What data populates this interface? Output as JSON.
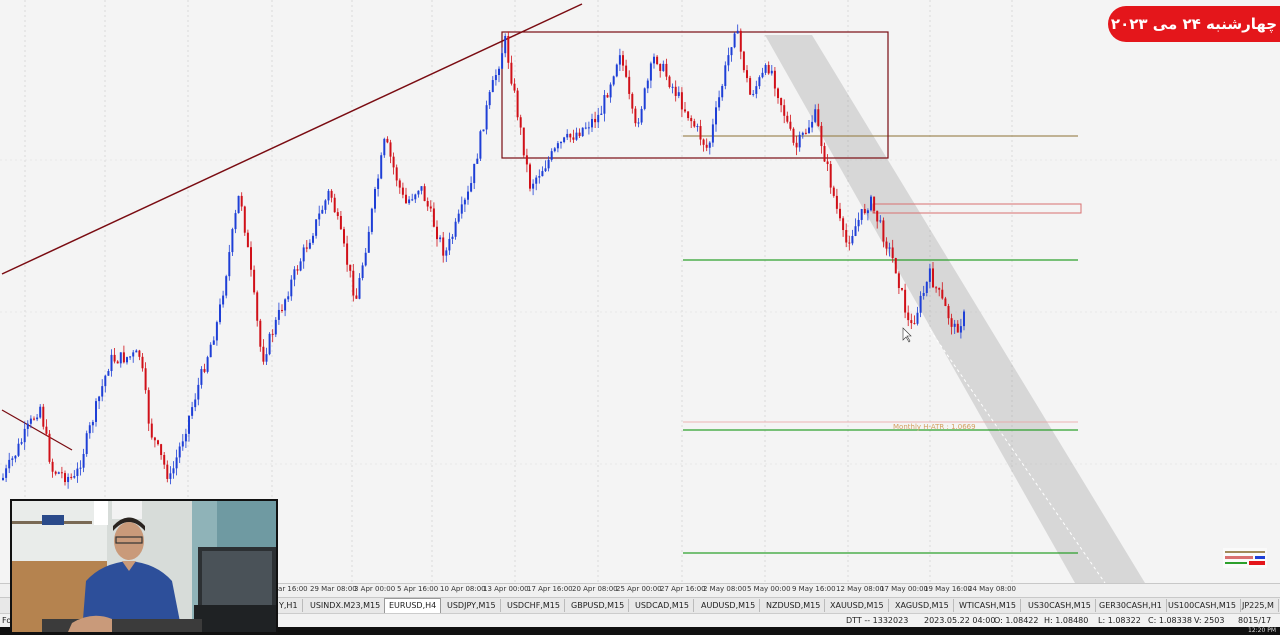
{
  "date_badge": "چهارشنبه ۲۴ می ۲۰۲۳",
  "chart": {
    "symbol_tab": "EURUSD,H4",
    "annotation": "Monthly H-ATR : 1.0669",
    "time_labels": [
      "Mar 16:00",
      "29 Mar 08:00",
      "3 Apr 00:00",
      "5 Apr 16:00",
      "10 Apr 08:00",
      "13 Apr 00:00",
      "17 Apr 16:00",
      "20 Apr 08:00",
      "25 Apr 00:00",
      "27 Apr 16:00",
      "2 May 08:00",
      "5 May 00:00",
      "9 May 16:00",
      "12 May 08:00",
      "17 May 00:00",
      "19 May 16:00",
      "24 May 08:00"
    ],
    "colors": {
      "bull": "#1e3fd6",
      "bear": "#d01018",
      "trendline": "#7a0c12",
      "box": "#7a0c12",
      "green_level": "#2ca02c",
      "olive_level": "#a08a5a",
      "channel": "#9a9a9a"
    }
  },
  "tabs": [
    "Y,H1",
    "USINDX.M23,M15",
    "EURUSD,H4",
    "USDJPY,M15",
    "USDCHF,M15",
    "GBPUSD,M15",
    "USDCAD,M15",
    "AUDUSD,M15",
    "NZDUSD,M15",
    "XAUUSD,M15",
    "XAGUSD,M15",
    "WTICASH,M15",
    "US30CASH,M15",
    "GER30CASH,H1",
    "US100CASH,M15",
    "JP225,M"
  ],
  "status": {
    "left": "For",
    "default": "DTT -- 1332023",
    "datetime": "2023.05.22 04:00",
    "open": "O: 1.08422",
    "high": "H: 1.08480",
    "low": "L: 1.08322",
    "close": "C: 1.08338",
    "volume": "V: 2503",
    "traffic": "8015/17",
    "clock": "12:20 PM"
  },
  "webcam": {
    "description_icon": "presenter-video-icon"
  }
}
